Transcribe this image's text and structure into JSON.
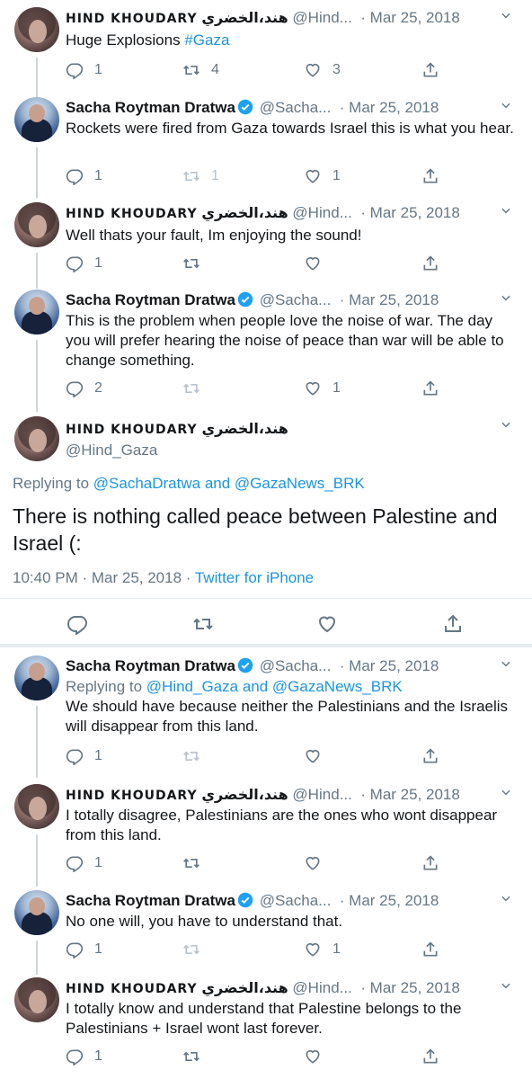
{
  "icons": {
    "reply": "reply-icon",
    "retweet": "retweet-icon",
    "like": "like-icon",
    "share": "share-icon",
    "verified": "verified-badge-icon",
    "more": "chevron-down-icon"
  },
  "colors": {
    "link": "#1b95e0",
    "muted": "#657786",
    "line": "#ccd6dd"
  },
  "tweets": [
    {
      "name": "HIND KHOUDARY",
      "arabic": "هند،الخضري",
      "handle": "@Hind...",
      "date": "Mar 25, 2018",
      "body_plain": "Huge Explosions ",
      "body_tag": "#Gaza",
      "reply_count": "1",
      "retweet_count": "4",
      "like_count": "3"
    },
    {
      "name": "Sacha Roytman Dratwa",
      "handle": "@Sacha...",
      "date": "Mar 25, 2018",
      "body": "Rockets were fired from Gaza towards Israel this is what you hear.",
      "reply_count": "1",
      "retweet_count": "1",
      "like_count": "1"
    },
    {
      "name": "HIND KHOUDARY",
      "arabic": "هند،الخضري",
      "handle": "@Hind...",
      "date": "Mar 25, 2018",
      "body": "Well thats your fault, Im enjoying the sound!",
      "reply_count": "1"
    },
    {
      "name": "Sacha Roytman Dratwa",
      "handle": "@Sacha...",
      "date": "Mar 25, 2018",
      "body": "This is the problem when people love the noise of war. The day you will prefer hearing the noise of peace than war will be able to change something.",
      "reply_count": "2",
      "like_count": "1"
    }
  ],
  "main_tweet": {
    "name": "HIND KHOUDARY",
    "arabic": "هند،الخضري",
    "handle": "@Hind_Gaza",
    "replying_prefix": "Replying to ",
    "replying_user1": "@SachaDratwa",
    "replying_and": " and ",
    "replying_user2": "@GazaNews_BRK",
    "text": "There is nothing called peace between Palestine and Israel (:",
    "time": "10:40 PM · Mar 25, 2018 · ",
    "source": "Twitter for iPhone"
  },
  "replies": [
    {
      "name": "Sacha Roytman Dratwa",
      "handle": "@Sacha...",
      "date": "Mar 25, 2018",
      "replying_prefix": "Replying to ",
      "replying_user1": "@Hind_Gaza",
      "replying_and": " and ",
      "replying_user2": "@GazaNews_BRK",
      "body": "We should have because neither the Palestinians and the Israelis will disappear from this land.",
      "reply_count": "1"
    },
    {
      "name": "HIND KHOUDARY",
      "arabic": "هند،الخضري",
      "handle": "@Hind...",
      "date": "Mar 25, 2018",
      "body": "I totally disagree, Palestinians are the ones who wont disappear from this land.",
      "reply_count": "1"
    },
    {
      "name": "Sacha Roytman Dratwa",
      "handle": "@Sacha...",
      "date": "Mar 25, 2018",
      "body": "No one will, you have to understand that.",
      "reply_count": "1",
      "like_count": "1"
    },
    {
      "name": "HIND KHOUDARY",
      "arabic": "هند،الخضري",
      "handle": "@Hind...",
      "date": "Mar 25, 2018",
      "body": "I totally know and understand that Palestine belongs to the Palestinians + Israel wont last forever.",
      "reply_count": "1"
    }
  ]
}
